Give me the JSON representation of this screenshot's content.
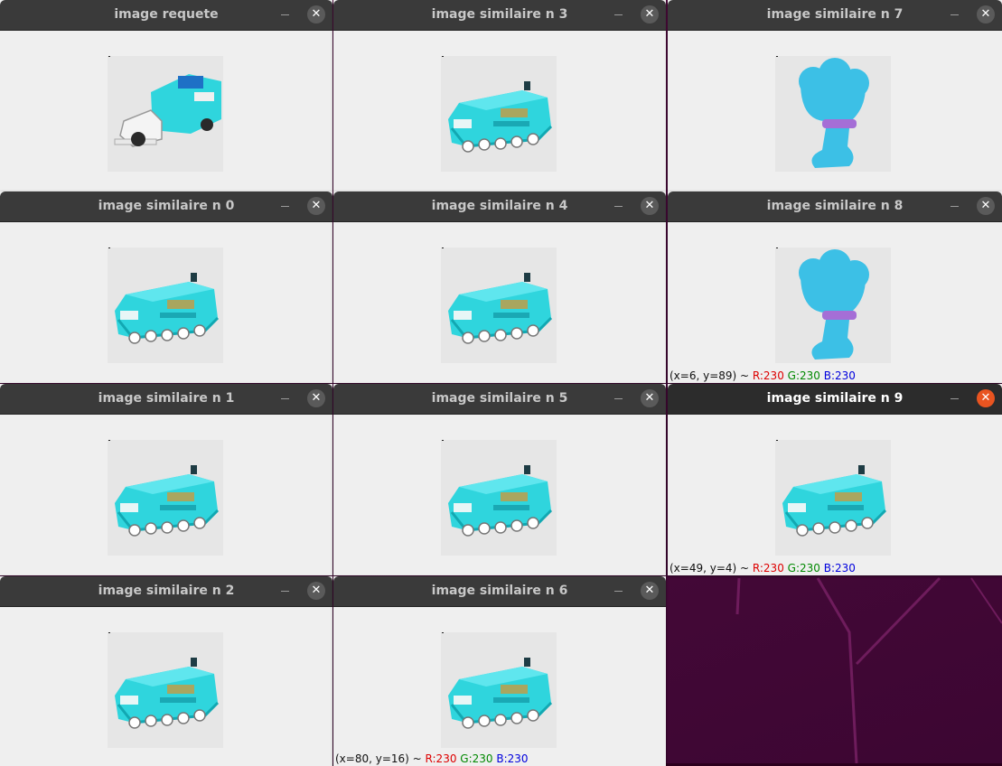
{
  "colors": {
    "titlebar": "#3a3a3a",
    "titlebar_active": "#2c2c2c",
    "close_active": "#e95420",
    "content_bg": "#efefef",
    "desktop": "#4a0a3c",
    "vehicle": "#2fd5dd",
    "mascot": "#3cc0e6"
  },
  "windows": [
    {
      "title": "image requete",
      "min_label": "–",
      "close_label": "✕",
      "subject": "vintage-truck"
    },
    {
      "title": "image similaire n 3",
      "min_label": "–",
      "close_label": "✕",
      "subject": "fire-truck"
    },
    {
      "title": "image similaire n 7",
      "min_label": "–",
      "close_label": "✕",
      "subject": "mascot"
    },
    {
      "title": "image similaire n 0",
      "min_label": "–",
      "close_label": "✕",
      "subject": "fire-truck"
    },
    {
      "title": "image similaire n 4",
      "min_label": "–",
      "close_label": "✕",
      "subject": "fire-truck"
    },
    {
      "title": "image similaire n 8",
      "min_label": "–",
      "close_label": "✕",
      "subject": "mascot",
      "status": {
        "coords": "(x=6, y=89) ~",
        "r": "R:230",
        "g": "G:230",
        "b": "B:230"
      }
    },
    {
      "title": "image similaire n 1",
      "min_label": "–",
      "close_label": "✕",
      "subject": "fire-truck"
    },
    {
      "title": "image similaire n 5",
      "min_label": "–",
      "close_label": "✕",
      "subject": "fire-truck"
    },
    {
      "title": "image similaire n 9",
      "min_label": "–",
      "close_label": "✕",
      "subject": "fire-truck",
      "active": true,
      "status": {
        "coords": "(x=49, y=4) ~",
        "r": "R:230",
        "g": "G:230",
        "b": "B:230"
      }
    },
    {
      "title": "image similaire n 2",
      "min_label": "–",
      "close_label": "✕",
      "subject": "fire-truck"
    },
    {
      "title": "image similaire n 6",
      "min_label": "–",
      "close_label": "✕",
      "subject": "fire-truck",
      "status": {
        "coords": "(x=80, y=16) ~",
        "r": "R:230",
        "g": "G:230",
        "b": "B:230"
      }
    }
  ]
}
